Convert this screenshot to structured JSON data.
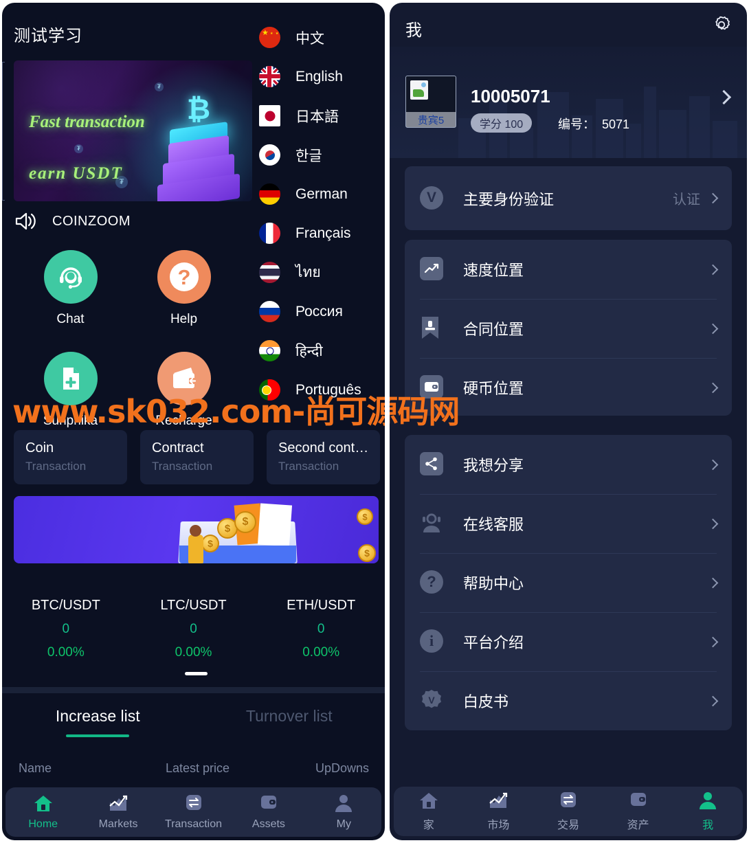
{
  "watermark": "www.sk032.com-尚可源码网",
  "left": {
    "title": "测试学习",
    "hero": {
      "line1": "Fast transaction",
      "line2": "earn  USDT"
    },
    "brand": "COINZOOM",
    "actions": [
      {
        "label": "Chat",
        "icon": "headset-icon",
        "color": "#3fc9a2"
      },
      {
        "label": "Help",
        "icon": "question-mark-icon",
        "color": "#ef8a5c"
      },
      {
        "label": "Sunpnika",
        "icon": "document-plus-icon",
        "color": "#3fc9a2"
      },
      {
        "label": "Recharge",
        "icon": "wallet-icon",
        "color": "#f09a73"
      }
    ],
    "txn_buttons": [
      {
        "title": "Coin",
        "subtitle": "Transaction"
      },
      {
        "title": "Contract",
        "subtitle": "Transaction"
      },
      {
        "title": "Second cont…",
        "subtitle": "Transaction"
      }
    ],
    "tickers": [
      {
        "symbol": "BTC/USDT",
        "price": "0",
        "change": "0.00%"
      },
      {
        "symbol": "LTC/USDT",
        "price": "0",
        "change": "0.00%"
      },
      {
        "symbol": "ETH/USDT",
        "price": "0",
        "change": "0.00%"
      }
    ],
    "tabs": [
      {
        "label": "Increase list",
        "active": true
      },
      {
        "label": "Turnover list",
        "active": false
      }
    ],
    "table_headers": {
      "name": "Name",
      "price": "Latest price",
      "updowns": "UpDowns"
    },
    "nav": [
      {
        "label": "Home",
        "icon": "home-icon",
        "active": true
      },
      {
        "label": "Markets",
        "icon": "chart-icon",
        "active": false
      },
      {
        "label": "Transaction",
        "icon": "exchange-icon",
        "active": false
      },
      {
        "label": "Assets",
        "icon": "wallet-icon",
        "active": false
      },
      {
        "label": "My",
        "icon": "person-icon",
        "active": false
      }
    ]
  },
  "languages": [
    {
      "name": "中文",
      "flag": "f-cn"
    },
    {
      "name": "English",
      "flag": "f-uk"
    },
    {
      "name": "日本語",
      "flag": "f-jp"
    },
    {
      "name": "한글",
      "flag": "f-kr"
    },
    {
      "name": "German",
      "flag": "f-de"
    },
    {
      "name": "Français",
      "flag": "f-fr"
    },
    {
      "name": "ไทย",
      "flag": "f-th"
    },
    {
      "name": "Россия",
      "flag": "f-ru"
    },
    {
      "name": "हिन्दी",
      "flag": "f-in"
    },
    {
      "name": "Português",
      "flag": "f-pt"
    }
  ],
  "right": {
    "title": "我",
    "profile": {
      "avatar_caption": "贵宾5",
      "uid": "10005071",
      "credit_badge": "学分 100",
      "number_label": "编号：",
      "number_value": "5071"
    },
    "verify": {
      "label": "主要身份验证",
      "value": "认证",
      "icon": "v-badge-icon"
    },
    "group1": [
      {
        "label": "速度位置",
        "icon": "trend-chart-icon"
      },
      {
        "label": "合同位置",
        "icon": "bookmark-stamp-icon"
      },
      {
        "label": "硬币位置",
        "icon": "wallet-icon"
      }
    ],
    "group2": [
      {
        "label": "我想分享",
        "icon": "share-icon"
      },
      {
        "label": "在线客服",
        "icon": "headset-person-icon"
      },
      {
        "label": "帮助中心",
        "icon": "question-mark-icon"
      },
      {
        "label": "平台介绍",
        "icon": "info-icon"
      },
      {
        "label": "白皮书",
        "icon": "v-badge-icon"
      }
    ],
    "nav": [
      {
        "label": "家",
        "icon": "home-icon",
        "active": false
      },
      {
        "label": "市场",
        "icon": "chart-icon",
        "active": false
      },
      {
        "label": "交易",
        "icon": "exchange-icon",
        "active": false
      },
      {
        "label": "资产",
        "icon": "wallet-icon",
        "active": false
      },
      {
        "label": "我",
        "icon": "person-icon",
        "active": true
      }
    ]
  },
  "colors": {
    "accent_green": "#13c08a",
    "accent_orange": "#ef8a5c",
    "panel_bg": "#0b1022",
    "card_bg": "#222a45",
    "watermark": "#f2711c"
  }
}
